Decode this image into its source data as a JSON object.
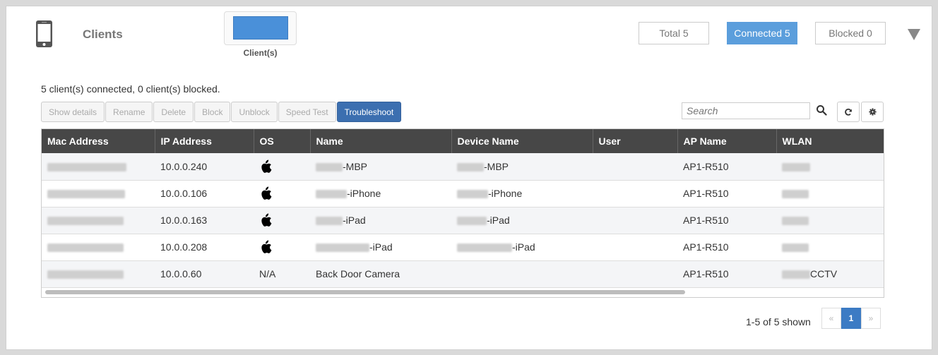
{
  "header": {
    "title": "Clients",
    "chart_label": "Client(s)",
    "chart_fill_fraction": 1.0,
    "filters": [
      {
        "label": "Total 5",
        "active": false
      },
      {
        "label": "Connected 5",
        "active": true
      },
      {
        "label": "Blocked 0",
        "active": false
      }
    ]
  },
  "summary": "5 client(s) connected, 0 client(s) blocked.",
  "toolbar": {
    "show_details": "Show details",
    "rename": "Rename",
    "delete": "Delete",
    "block": "Block",
    "unblock": "Unblock",
    "speed_test": "Speed Test",
    "troubleshoot": "Troubleshoot"
  },
  "search": {
    "placeholder": "Search",
    "value": ""
  },
  "table": {
    "columns": [
      "Mac Address",
      "IP Address",
      "OS",
      "Name",
      "Device Name",
      "User",
      "AP Name",
      "WLAN"
    ],
    "rows": [
      {
        "ip": "10.0.0.240",
        "os": "",
        "os_icon": "apple-icon",
        "name_suffix": "-MBP",
        "device_suffix": "-MBP",
        "user": "",
        "ap": "AP1-R510",
        "wlan_suffix": ""
      },
      {
        "ip": "10.0.0.106",
        "os": "",
        "os_icon": "apple-icon",
        "name_suffix": "-iPhone",
        "device_suffix": "-iPhone",
        "user": "",
        "ap": "AP1-R510",
        "wlan_suffix": ""
      },
      {
        "ip": "10.0.0.163",
        "os": "",
        "os_icon": "apple-icon",
        "name_suffix": "-iPad",
        "device_suffix": "-iPad",
        "user": "",
        "ap": "AP1-R510",
        "wlan_suffix": ""
      },
      {
        "ip": "10.0.0.208",
        "os": "",
        "os_icon": "apple-icon",
        "name_suffix": "-iPad",
        "device_suffix": "-iPad",
        "user": "",
        "ap": "AP1-R510",
        "wlan_suffix": ""
      },
      {
        "ip": "10.0.0.60",
        "os": "N/A",
        "os_icon": "",
        "name_suffix": "Back Door Camera",
        "device_suffix": "",
        "user": "",
        "ap": "AP1-R510",
        "wlan_suffix": "CCTV"
      }
    ]
  },
  "pagination": {
    "shown": "1-5 of 5 shown",
    "prev": "«",
    "current": "1",
    "next": "»"
  },
  "colors": {
    "accent": "#5b9edc",
    "primary_button": "#3c6fb0",
    "table_header": "#474747"
  }
}
